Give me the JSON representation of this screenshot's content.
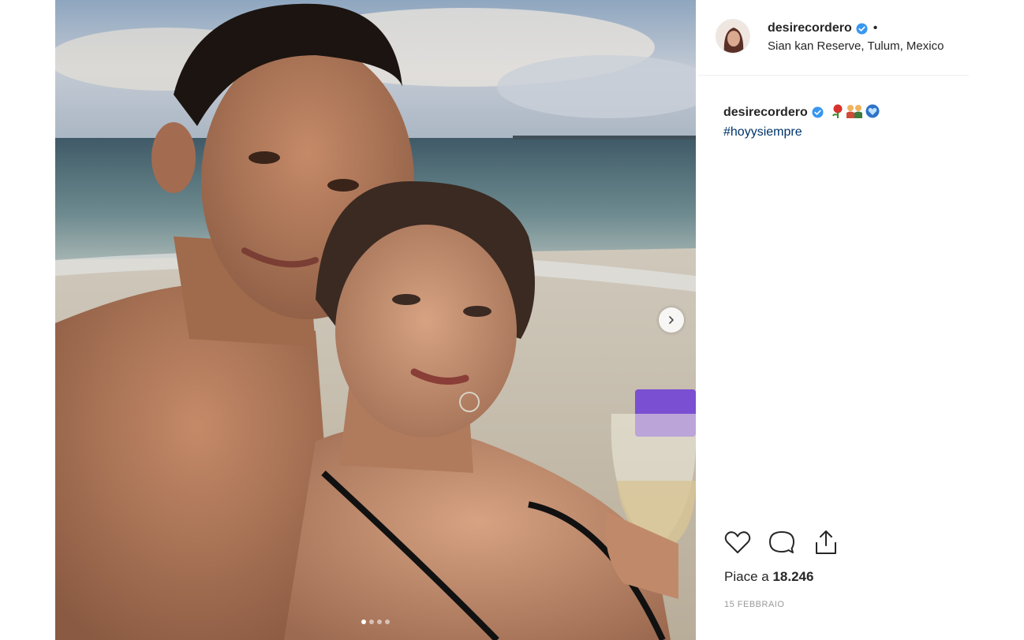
{
  "post": {
    "username": "desirecordero",
    "separator": "•",
    "location": "Sian kan Reserve, Tulum, Mexico",
    "caption_user": "desirecordero",
    "caption_emojis": [
      "rose-emoji",
      "couple-emoji",
      "blue-heart-emoji"
    ],
    "hashtag": "#hoyysiempre",
    "likes_prefix": "Piace a",
    "likes_count": "18.246",
    "date": "15 FEBBRAIO",
    "carousel": {
      "total": 4,
      "active": 1
    }
  },
  "colors": {
    "verified": "#3897f0",
    "hashtag": "#003569",
    "text": "#262626",
    "muted": "#999999"
  }
}
